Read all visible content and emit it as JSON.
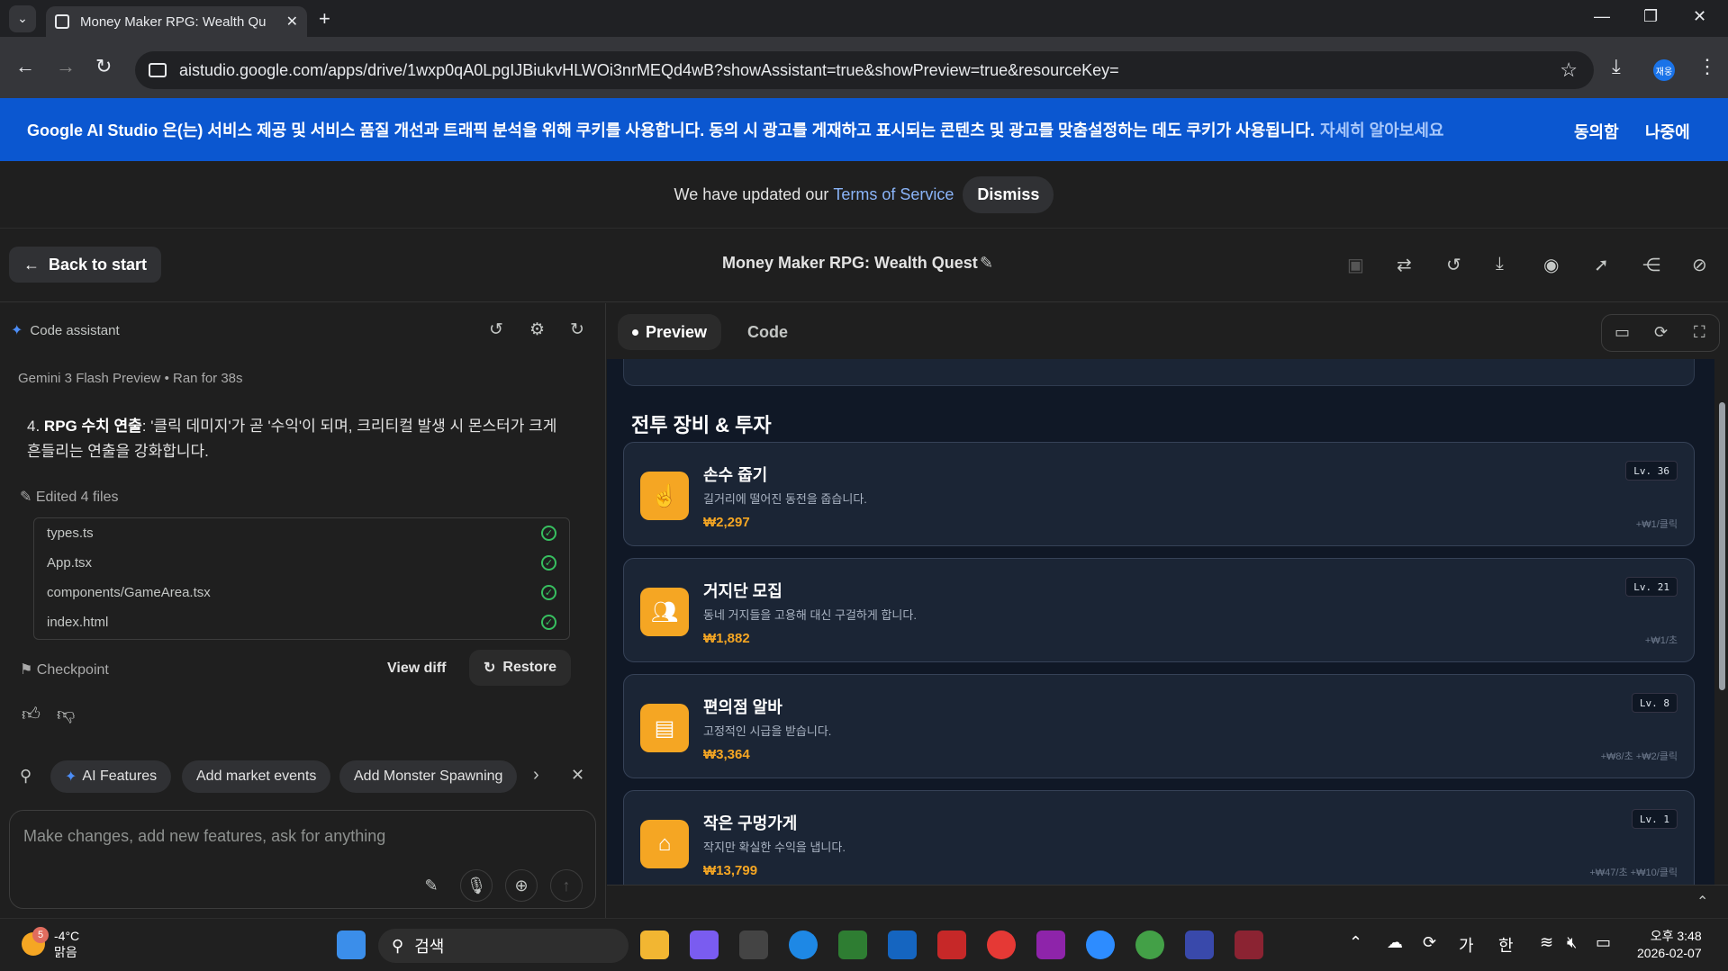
{
  "browser": {
    "tab_title": "Money Maker RPG: Wealth Qu",
    "url": "aistudio.google.com/apps/drive/1wxp0qA0LpgIJBiukvHLWOi3nrMEQd4wB?showAssistant=true&showPreview=true&resourceKey=",
    "profile_label": "재웅"
  },
  "cookie_banner": {
    "text": "Google AI Studio 은(는) 서비스 제공 및 서비스 품질 개선과 트래픽 분석을 위해 쿠키를 사용합니다. 동의 시 광고를 게재하고 표시되는 콘텐츠 및 광고를 맞춤설정하는 데도 쿠키가 사용됩니다.",
    "learn_more": "자세히 알아보세요",
    "agree": "동의함",
    "later": "나중에"
  },
  "tos_bar": {
    "text": "We have updated our",
    "link": "Terms of Service",
    "dismiss": "Dismiss"
  },
  "header": {
    "back_label": "Back to start",
    "project_title": "Money Maker RPG: Wealth Quest"
  },
  "assistant": {
    "title": "Code assistant",
    "model": "Gemini 3 Flash Preview",
    "ran_for": "Ran for 38s",
    "step_number": "4.",
    "step_bold": "RPG 수치 연출",
    "step_text": ": '클릭 데미지'가 곧 '수익'이 되며, 크리티컬 발생 시 몬스터가 크게 흔들리는 연출을 강화합니다.",
    "edited_label": "Edited 4 files",
    "files": [
      "types.ts",
      "App.tsx",
      "components/GameArea.tsx",
      "index.html"
    ],
    "checkpoint": "Checkpoint",
    "view_diff": "View diff",
    "restore": "Restore",
    "suggestions": [
      "AI Features",
      "Add market events",
      "Add Monster Spawning"
    ],
    "input_placeholder": "Make changes, add new features, ask for anything"
  },
  "preview": {
    "tabs": [
      "Preview",
      "Code"
    ],
    "section_title": "전투 장비 & 투자",
    "items": [
      {
        "name": "손수 줍기",
        "desc": "길거리에 떨어진 동전을 줍습니다.",
        "price": "₩2,297",
        "level": "Lv. 36",
        "rate": "+₩1/클릭",
        "icon": "hand-pointer-icon"
      },
      {
        "name": "거지단 모집",
        "desc": "동네 거지들을 고용해 대신 구걸하게 합니다.",
        "price": "₩1,882",
        "level": "Lv. 21",
        "rate": "+₩1/초",
        "icon": "users-icon"
      },
      {
        "name": "편의점 알바",
        "desc": "고정적인 시급을 받습니다.",
        "price": "₩3,364",
        "level": "Lv. 8",
        "rate": "+₩8/초 +₩2/클릭",
        "icon": "store-icon"
      },
      {
        "name": "작은 구멍가게",
        "desc": "작지만 확실한 수익을 냅니다.",
        "price": "₩13,799",
        "level": "Lv. 1",
        "rate": "+₩47/초 +₩10/클릭",
        "icon": "shop-icon"
      }
    ]
  },
  "taskbar": {
    "weather_badge": "5",
    "temperature": "-4°C",
    "condition": "맑음",
    "search_label": "검색",
    "ime_1": "가",
    "ime_2": "한",
    "time": "오후 3:48",
    "date": "2026-02-07"
  },
  "colors": {
    "accent_orange": "#f5a623",
    "banner_blue": "#0b57d0",
    "preview_bg": "#101826",
    "card_bg": "#1b2535"
  }
}
